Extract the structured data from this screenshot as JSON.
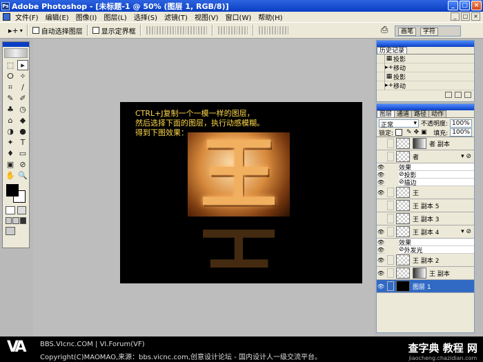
{
  "window": {
    "title": "Adobe Photoshop - [未标题-1 @ 50% (图层 1, RGB/8)]",
    "min": "_",
    "max": "□",
    "close": "×"
  },
  "menu": [
    "文件(F)",
    "编辑(E)",
    "图像(I)",
    "图层(L)",
    "选择(S)",
    "滤镜(T)",
    "视图(V)",
    "窗口(W)",
    "帮助(H)"
  ],
  "options": {
    "tool_glyph": "▸+",
    "auto_select": "自动选择图层",
    "show_bounds": "显示定界框"
  },
  "well": {
    "tabs": [
      "画笔",
      "字符"
    ]
  },
  "tools": [
    "⬚",
    "▸",
    "ⵔ",
    "✧",
    "⌗",
    "∕",
    "✎",
    "✐",
    "♣",
    "◷",
    "⌂",
    "◆",
    "◑",
    "●",
    "✦",
    "T",
    "♦",
    "▭",
    "▣",
    "⊘",
    "✋",
    "🔍"
  ],
  "colors": {
    "foreground": "#000000",
    "background": "#ffffff",
    "accent": "#0a3fc4",
    "caption": "#ffd84a"
  },
  "canvas": {
    "caption": [
      "CTRL+J复制一个一模一样的图层，",
      "然后选择下面的图层，执行动感模糊。",
      "得到下图效果："
    ],
    "glyph": "王"
  },
  "history": {
    "tabs": [
      "历史记录"
    ],
    "items": [
      {
        "icon": "▦",
        "label": "投影"
      },
      {
        "icon": "▸+",
        "label": "移动"
      },
      {
        "icon": "▦",
        "label": "投影"
      },
      {
        "icon": "▸+",
        "label": "移动"
      }
    ]
  },
  "layers": {
    "tabs": [
      "图层",
      "通道",
      "路径",
      "动作"
    ],
    "blend_mode": "正常",
    "opacity_label": "不透明度:",
    "opacity_value": "100%",
    "lock_label": "锁定:",
    "fill_label": "填充:",
    "fill_value": "100%",
    "rows": [
      {
        "name": "者 副本"
      },
      {
        "name": "者"
      },
      {
        "fx": "效果"
      },
      {
        "fx": "投影"
      },
      {
        "fx": "描边"
      },
      {
        "name": "王"
      },
      {
        "name": "王 副本 5"
      },
      {
        "name": "王 副本 3"
      },
      {
        "name": "王 副本 4"
      },
      {
        "fx": "效果"
      },
      {
        "fx": "外发光"
      },
      {
        "name": "王 副本 2"
      },
      {
        "name": "王 副本"
      },
      {
        "name": "图层 1"
      }
    ]
  },
  "footer": {
    "line1": "BBS.VIcnc.COM | VI.Forum(VF)",
    "line2": "Copyright(C)MAOMAO,来源：bbs.vicnc.com,创意设计论坛 - 国内设计人一级交流平台。",
    "logo": "VA",
    "watermark1": "查字典 教程 网",
    "watermark2": "jiaocheng.chazidian.com"
  }
}
